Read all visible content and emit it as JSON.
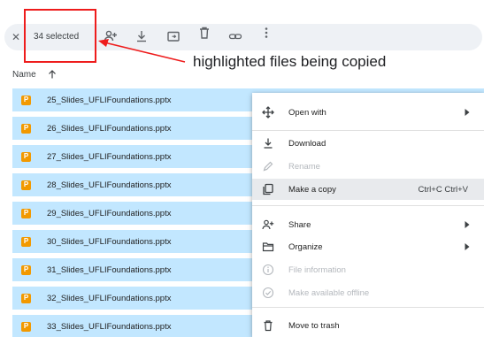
{
  "toolbar": {
    "close_icon": "close-icon",
    "selected_count": "34 selected",
    "icons": [
      "share-person-icon",
      "download-icon",
      "move-folder-icon",
      "trash-icon",
      "link-icon",
      "more-vert-icon"
    ]
  },
  "annotation": {
    "text": "highlighted files being copied",
    "box_color": "#ee1c1c"
  },
  "list_header": {
    "name_label": "Name",
    "sort_icon": "arrow-up-icon"
  },
  "files": [
    "25_Slides_UFLIFoundations.pptx",
    "26_Slides_UFLIFoundations.pptx",
    "27_Slides_UFLIFoundations.pptx",
    "28_Slides_UFLIFoundations.pptx",
    "29_Slides_UFLIFoundations.pptx",
    "30_Slides_UFLIFoundations.pptx",
    "31_Slides_UFLIFoundations.pptx",
    "32_Slides_UFLIFoundations.pptx",
    "33_Slides_UFLIFoundations.pptx"
  ],
  "file_icon_letter": "P",
  "colors": {
    "selection": "#c2e7ff",
    "file_icon": "#f29900",
    "menu_highlight": "#e8eaed"
  },
  "context_menu": {
    "open_with": "Open with",
    "download": "Download",
    "rename": "Rename",
    "make_copy": "Make a copy",
    "make_copy_shortcut": "Ctrl+C Ctrl+V",
    "share": "Share",
    "organize": "Organize",
    "file_information": "File information",
    "make_available_offline": "Make available offline",
    "move_to_trash": "Move to trash"
  }
}
